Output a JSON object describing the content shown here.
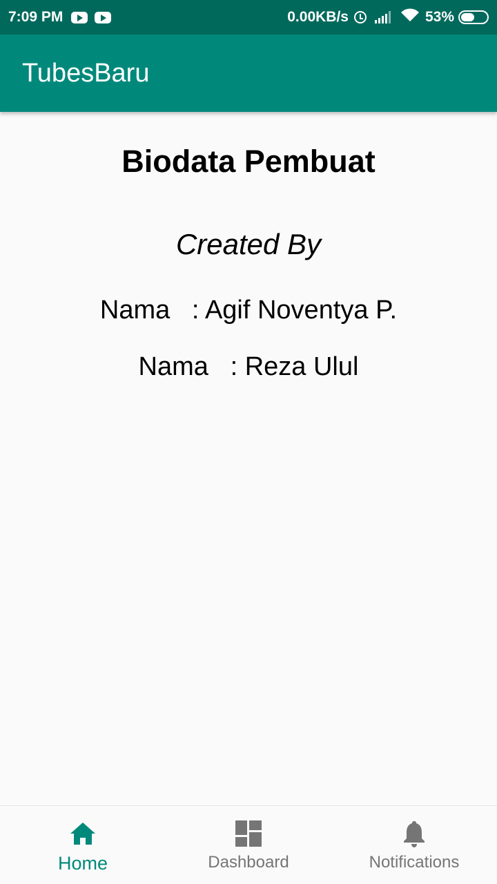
{
  "status_bar": {
    "time": "7:09 PM",
    "net_speed": "0.00KB/s",
    "battery_pct": "53%",
    "battery_level": 0.53
  },
  "app_bar": {
    "title": "TubesBaru"
  },
  "content": {
    "heading": "Biodata Pembuat",
    "subheading": "Created By",
    "rows": [
      {
        "text": "Nama   : Agif Noventya P."
      },
      {
        "text": "Nama   : Reza Ulul"
      }
    ]
  },
  "bottom_nav": {
    "items": [
      {
        "label": "Home",
        "icon": "home-icon",
        "active": true
      },
      {
        "label": "Dashboard",
        "icon": "dashboard-icon",
        "active": false
      },
      {
        "label": "Notifications",
        "icon": "bell-icon",
        "active": false
      }
    ]
  },
  "colors": {
    "status_bar": "#00695c",
    "app_bar": "#00897b",
    "active_nav": "#00897b",
    "inactive_nav": "#757575"
  }
}
